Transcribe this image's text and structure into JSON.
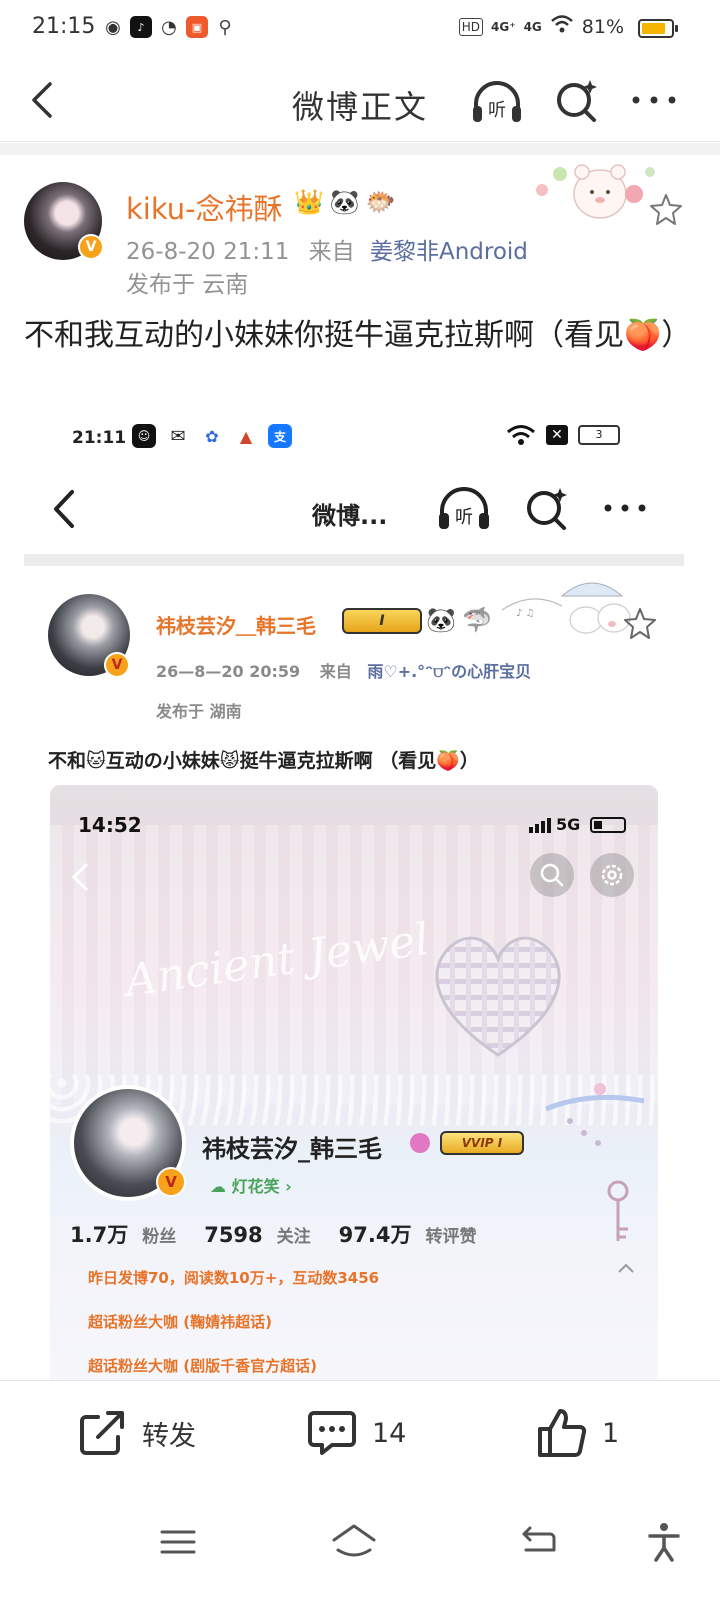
{
  "status_bar": {
    "time": "21:15",
    "network_tag": "HD",
    "net1": "4G⁺",
    "net2": "4G",
    "battery_percent": "81%",
    "battery_level": 0.81,
    "battery_color": "#f5b400"
  },
  "header": {
    "title": "微博正文",
    "listen_label": "听"
  },
  "post": {
    "username": "kiku-念祎酥",
    "username_color": "#e8742a",
    "time": "26-8-20 21:11",
    "source_prefix": "来自",
    "source": "姜黎非Android",
    "location": "发布于 云南",
    "text": "不和我互动的小妹妹你挺牛逼克拉斯啊（看见🍑）",
    "badges": [
      "🐼",
      "🐡"
    ]
  },
  "screenshot": {
    "time": "21:11",
    "battery": "3",
    "title": "微博...",
    "listen_label": "听",
    "username": "祎枝芸汐＿韩三毛",
    "vip_label": "I",
    "datetime": "26—8—20  20:59",
    "source_prefix": "来自",
    "source": "雨♡+.°ᵔ⩌ᵔの心肝宝贝",
    "location": "发布于  湖南",
    "text": "不和🐱互动の小妹妹😾挺牛逼克拉斯啊 （看见🍑）",
    "profile": {
      "time": "14:52",
      "network": "5G",
      "cursive": "Ancient  Jewel",
      "name": "祎枝芸汐_韩三毛",
      "vvip_label": "VVIP I",
      "lamp_label": "☁ 灯花笑 ›",
      "followers_num": "1.7万",
      "followers_label": "粉丝",
      "following_num": "7598",
      "following_label": "关注",
      "interact_num": "97.4万",
      "interact_label": "转评赞",
      "line1": "昨日发博70，阅读数10万+，互动数3456",
      "line2": "超话粉丝大咖 (鞠婧祎超话)",
      "line3": "超话粉丝大咖 (剧版千香官方超话)"
    }
  },
  "actions": {
    "repost_label": "转发",
    "comment_count": "14",
    "like_count": "1"
  }
}
